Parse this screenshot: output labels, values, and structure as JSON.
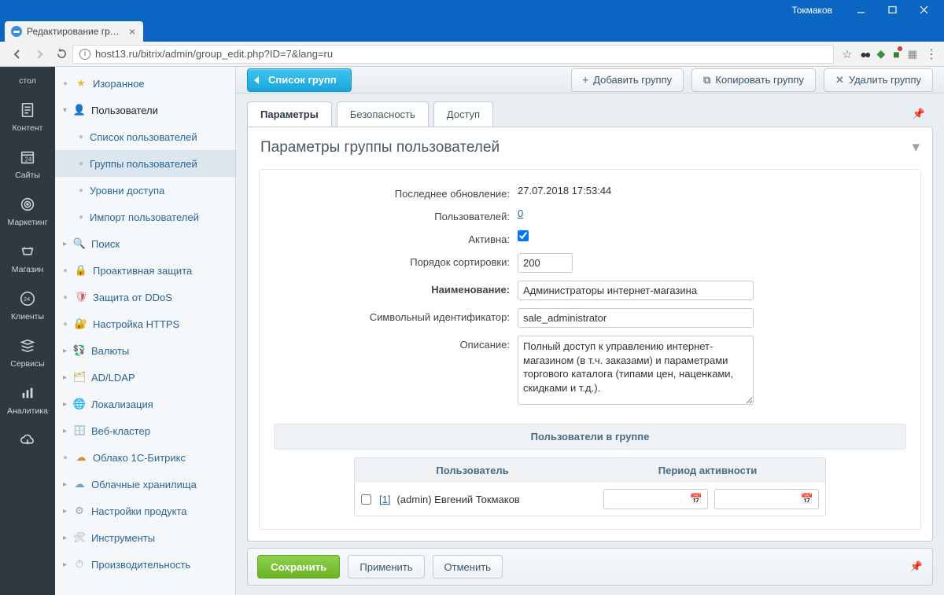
{
  "window": {
    "user": "Токмаков"
  },
  "browser": {
    "tab_title": "Редактирование группы",
    "url": "host13.ru/bitrix/admin/group_edit.php?ID=7&lang=ru"
  },
  "rail": [
    {
      "label": "стол",
      "icon": "desktop"
    },
    {
      "label": "Контент",
      "icon": "doc"
    },
    {
      "label": "Сайты",
      "icon": "cal"
    },
    {
      "label": "Маркетинг",
      "icon": "target"
    },
    {
      "label": "Магазин",
      "icon": "cart"
    },
    {
      "label": "Клиенты",
      "icon": "badge24"
    },
    {
      "label": "Сервисы",
      "icon": "stack"
    },
    {
      "label": "Аналитика",
      "icon": "bars"
    },
    {
      "label": "",
      "icon": "cloud"
    }
  ],
  "tree": {
    "fav": "Изоранное",
    "users": "Пользователи",
    "users_children": [
      "Список пользователей",
      "Группы пользователей",
      "Уровни доступа",
      "Импорт пользователей"
    ],
    "rest": [
      "Поиск",
      "Проактивная защита",
      "Защита от DDoS",
      "Настройка HTTPS",
      "Валюты",
      "AD/LDAP",
      "Локализация",
      "Веб-кластер",
      "Облако 1С-Битрикс",
      "Облачные хранилища",
      "Настройки продукта",
      "Инструменты",
      "Производительность"
    ]
  },
  "toolbar": {
    "back": "Список групп",
    "add": "Добавить группу",
    "copy": "Копировать группу",
    "del": "Удалить группу"
  },
  "tabs": {
    "t1": "Параметры",
    "t2": "Безопасность",
    "t3": "Доступ"
  },
  "panel": {
    "title": "Параметры группы пользователей",
    "labels": {
      "updated": "Последнее обновление:",
      "users": "Пользователей:",
      "active": "Активна:",
      "sort": "Порядок сортировки:",
      "name": "Наименование:",
      "sid": "Символьный идентификатор:",
      "desc": "Описание:"
    },
    "values": {
      "updated": "27.07.2018 17:53:44",
      "users": "0",
      "sort": "200",
      "name": "Администраторы интернет-магазина",
      "sid": "sale_administrator",
      "desc": "Полный доступ к управлению интернет-магазином (в т.ч. заказами) и параметрами торгового каталога (типами цен, наценками, скидками и т.д.)."
    },
    "users_section": "Пользователи в группе",
    "utable": {
      "col_user": "Пользователь",
      "col_period": "Период активности",
      "row_user_id": "[1]",
      "row_user_rest": " (admin) Евгений Токмаков"
    }
  },
  "footer": {
    "save": "Сохранить",
    "apply": "Применить",
    "cancel": "Отменить"
  }
}
